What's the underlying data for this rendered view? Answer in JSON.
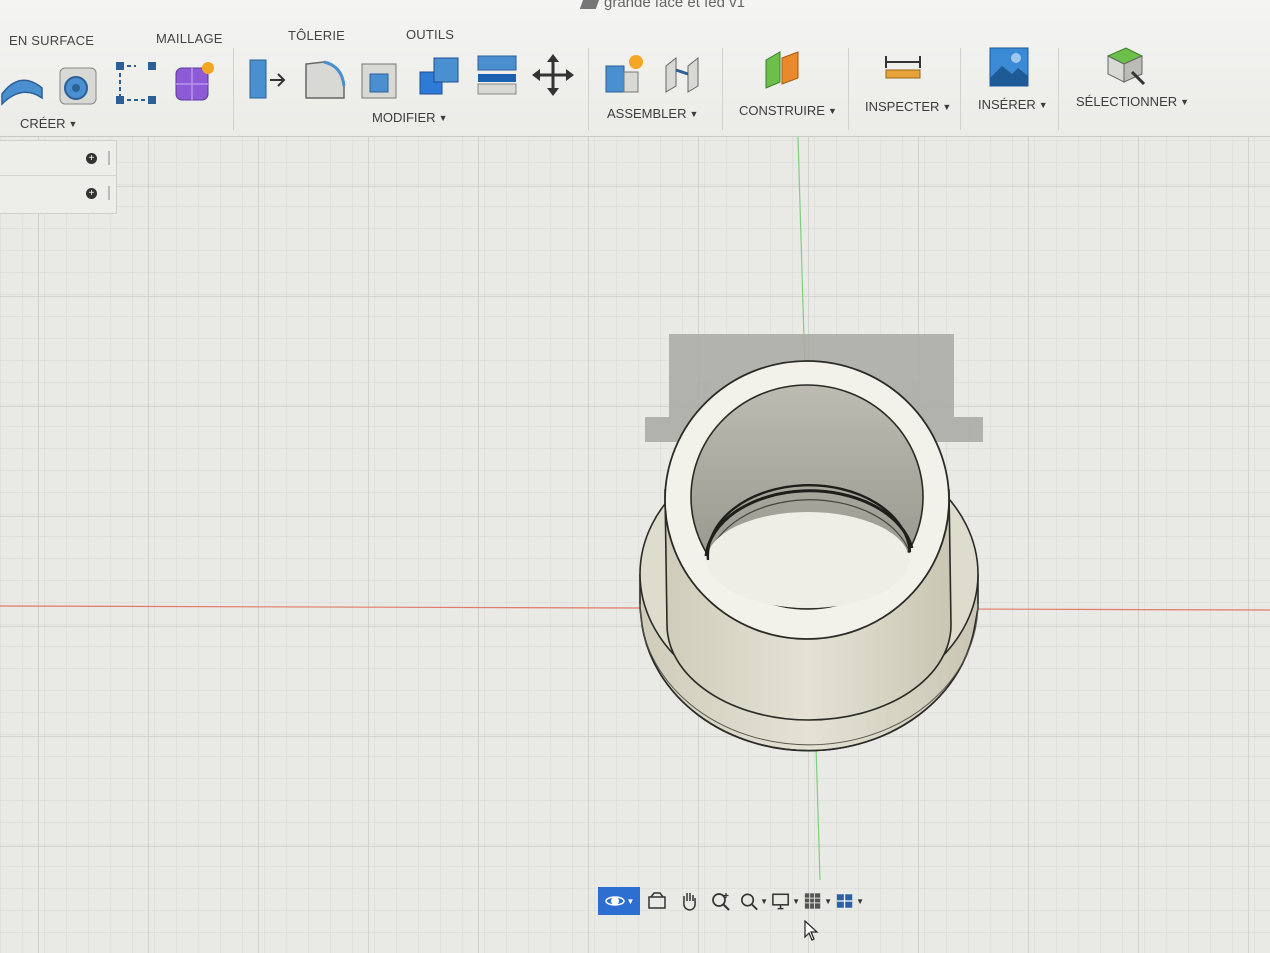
{
  "document": {
    "title": "grande face et fed v1"
  },
  "tabs": [
    "EN SURFACE",
    "MAILLAGE",
    "TÔLERIE",
    "OUTILS"
  ],
  "groups": {
    "creer": "CRÉER",
    "modifier": "MODIFIER",
    "assembler": "ASSEMBLER",
    "construire": "CONSTRUIRE",
    "inspecter": "INSPECTER",
    "inserer": "INSÉRER",
    "selectionner": "SÉLECTIONNER"
  },
  "tools": {
    "creer": [
      "surface-patch-icon",
      "revolve-solid-icon",
      "sketch-dimension-icon",
      "form-box-icon"
    ],
    "modifier": [
      "press-pull-icon",
      "fillet-icon",
      "shell-icon",
      "combine-icon",
      "split-body-icon",
      "move-icon"
    ],
    "assembler": [
      "new-component-icon",
      "joint-icon"
    ],
    "construire": [
      "offset-plane-icon"
    ],
    "inspecter": [
      "measure-icon"
    ],
    "inserer": [
      "insert-image-icon"
    ],
    "selectionner": [
      "select-icon"
    ]
  },
  "browser": {
    "rows": [
      "",
      ""
    ]
  },
  "navbar": {
    "items": [
      "orbit-icon",
      "look-at-icon",
      "pan-icon",
      "zoom-icon",
      "fit-icon",
      "display-settings-icon",
      "grid-snap-icon",
      "viewports-icon"
    ]
  },
  "colors": {
    "accent": "#2d6fd0",
    "part_body": "#e7e5d8",
    "grid_line": "#c8c8c4",
    "x_axis": "#e07a6a",
    "y_axis": "#7fcf7f"
  }
}
